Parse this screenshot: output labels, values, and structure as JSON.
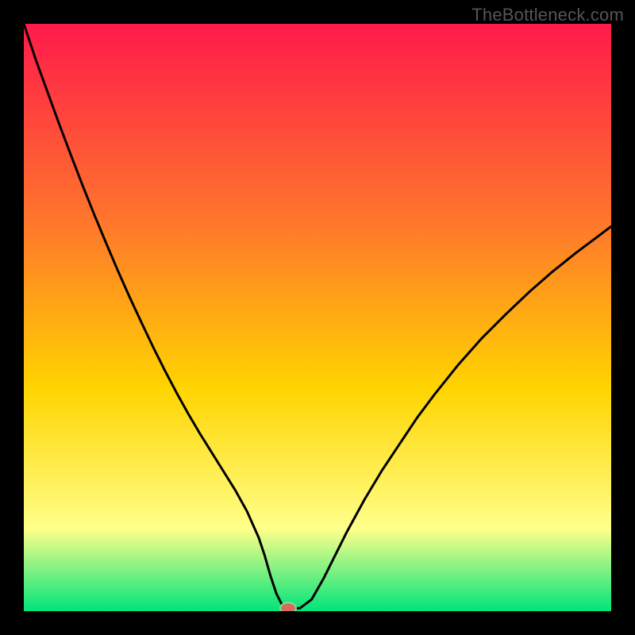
{
  "watermark": "TheBottleneck.com",
  "colors": {
    "background": "#000000",
    "gradient_top": "#ff1a4b",
    "gradient_mid_upper": "#ff7a2a",
    "gradient_mid": "#ffd400",
    "gradient_lower": "#ffff8a",
    "gradient_bottom": "#00e47a",
    "curve": "#000000",
    "marker_fill": "#d86a60",
    "marker_rim": "#7fe08f"
  },
  "chart_data": {
    "type": "line",
    "title": "",
    "xlabel": "",
    "ylabel": "",
    "xlim": [
      0,
      100
    ],
    "ylim": [
      0,
      100
    ],
    "grid": false,
    "legend": false,
    "series": [
      {
        "name": "bottleneck-curve",
        "x": [
          0,
          2,
          4,
          6,
          8,
          10,
          12,
          14,
          16,
          18,
          20,
          22,
          24,
          26,
          28,
          30,
          32,
          34,
          36,
          38,
          40,
          41,
          42,
          43,
          44,
          45,
          47,
          49,
          51,
          53,
          55,
          58,
          61,
          64,
          67,
          70,
          74,
          78,
          82,
          86,
          90,
          94,
          98,
          100
        ],
        "y": [
          100,
          94,
          88.5,
          83,
          77.7,
          72.5,
          67.5,
          62.7,
          58,
          53.5,
          49.2,
          45,
          41,
          37.2,
          33.6,
          30.2,
          27,
          23.8,
          20.6,
          17,
          12.5,
          9.5,
          6,
          3,
          1,
          0.5,
          0.5,
          2,
          5.5,
          9.5,
          13.5,
          19,
          24,
          28.5,
          33,
          37,
          42,
          46.5,
          50.5,
          54.3,
          57.8,
          61,
          64,
          65.5
        ]
      }
    ],
    "marker": {
      "x": 45,
      "y": 0.5
    }
  }
}
